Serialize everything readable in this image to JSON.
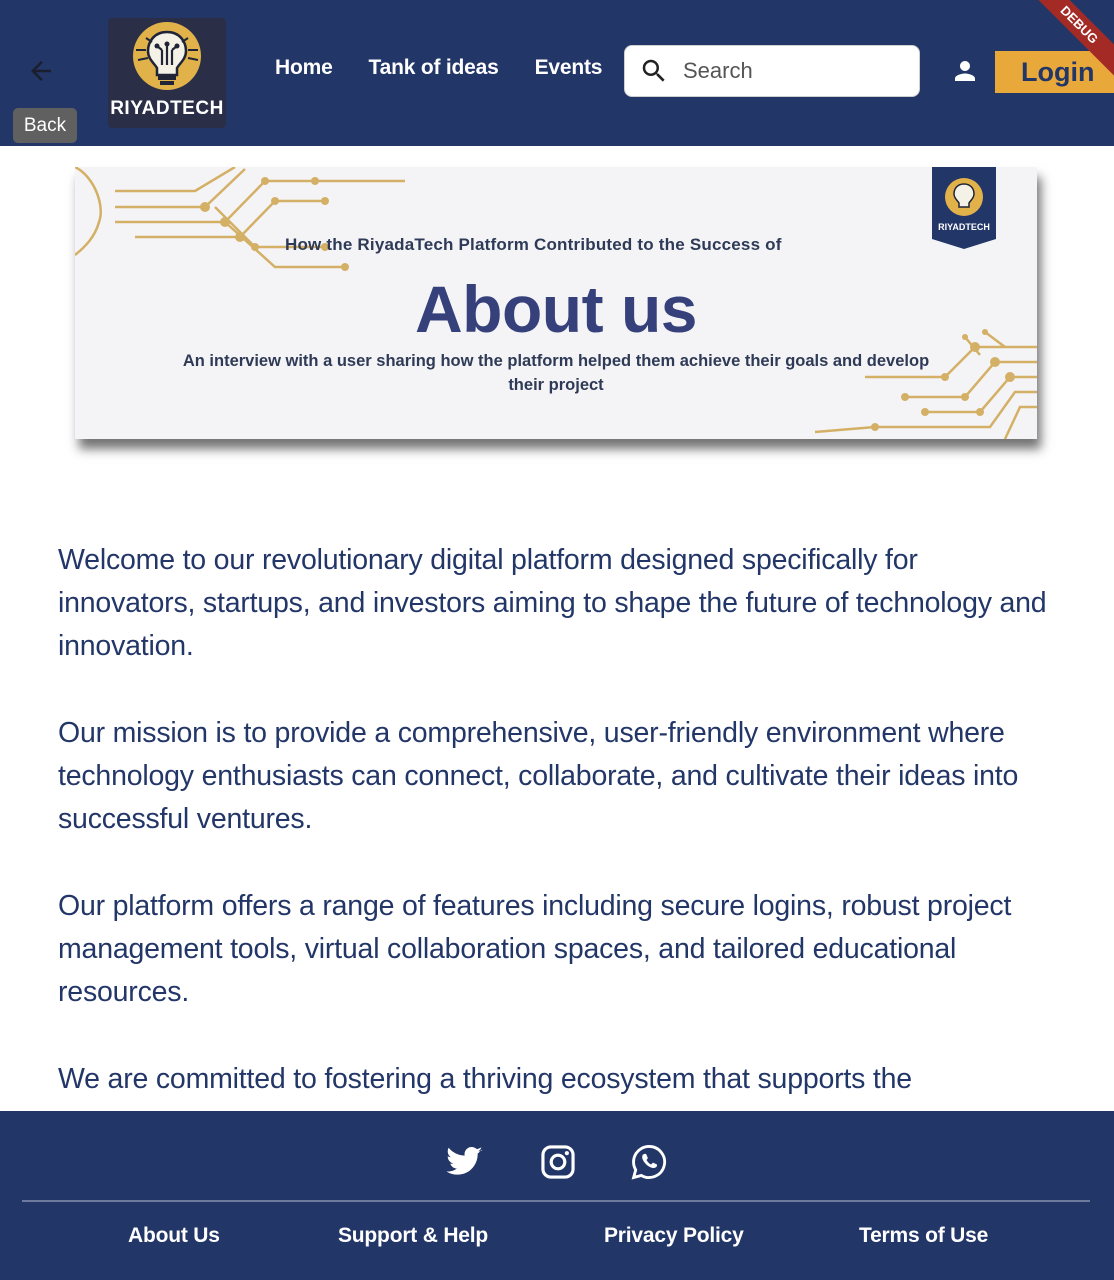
{
  "header": {
    "back_tooltip": "Back",
    "logo_text": "RIYADTECH",
    "nav": [
      "Home",
      "Tank of ideas",
      "Events"
    ],
    "search_placeholder": "Search",
    "login_label": "Login",
    "debug_label": "DEBUG"
  },
  "banner": {
    "subtitle": "How the RiyadaTech Platform Contributed to the Success of",
    "title": "About us",
    "description": "An interview with a user sharing how the platform helped them achieve their goals and develop their project",
    "badge_text": "RIYADTECH"
  },
  "content": {
    "paragraphs": [
      "Welcome to our revolutionary digital platform designed specifically for innovators, startups, and investors aiming to shape the future of technology and innovation.",
      "Our mission is to provide a comprehensive, user-friendly environment where technology enthusiasts can connect, collaborate, and cultivate their ideas into successful ventures.",
      "Our platform offers a range of features including secure logins, robust project management tools, virtual collaboration spaces, and tailored educational resources.",
      "We are committed to fostering a thriving ecosystem that supports the"
    ]
  },
  "footer": {
    "social_icons": [
      "twitter-icon",
      "instagram-icon",
      "whatsapp-icon"
    ],
    "links": [
      "About Us",
      "Support & Help",
      "Privacy Policy",
      "Terms of Use"
    ]
  },
  "colors": {
    "primary_navy": "#233668",
    "accent_gold": "#e8a93a",
    "debug_red": "#a32a25"
  }
}
